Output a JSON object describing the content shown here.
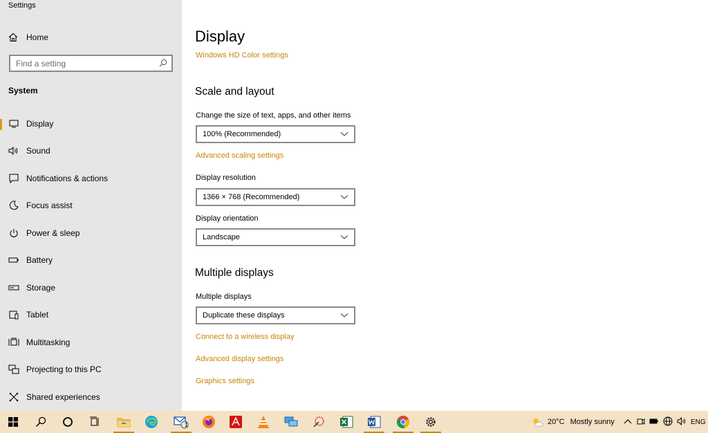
{
  "window": {
    "title": "Settings"
  },
  "sidebar": {
    "home_label": "Home",
    "search_placeholder": "Find a setting",
    "group_label": "System",
    "items": [
      {
        "label": "Display",
        "icon": "monitor-icon",
        "active": true
      },
      {
        "label": "Sound",
        "icon": "speaker-icon"
      },
      {
        "label": "Notifications & actions",
        "icon": "notification-icon"
      },
      {
        "label": "Focus assist",
        "icon": "moon-icon"
      },
      {
        "label": "Power & sleep",
        "icon": "power-icon"
      },
      {
        "label": "Battery",
        "icon": "battery-icon"
      },
      {
        "label": "Storage",
        "icon": "storage-icon"
      },
      {
        "label": "Tablet",
        "icon": "tablet-icon"
      },
      {
        "label": "Multitasking",
        "icon": "multitasking-icon"
      },
      {
        "label": "Projecting to this PC",
        "icon": "projecting-icon"
      },
      {
        "label": "Shared experiences",
        "icon": "shared-experiences-icon"
      }
    ]
  },
  "main": {
    "title": "Display",
    "hd_color_link": "Windows HD Color settings",
    "scale_section": {
      "heading": "Scale and layout",
      "scale_label": "Change the size of text, apps, and other items",
      "scale_value": "100% (Recommended)",
      "advanced_scaling_link": "Advanced scaling settings",
      "resolution_label": "Display resolution",
      "resolution_value": "1366 × 768 (Recommended)",
      "orientation_label": "Display orientation",
      "orientation_value": "Landscape"
    },
    "multi_section": {
      "heading": "Multiple displays",
      "label": "Multiple displays",
      "value": "Duplicate these displays",
      "wireless_link": "Connect to a wireless display",
      "advanced_display_link": "Advanced display settings",
      "graphics_link": "Graphics settings"
    }
  },
  "taskbar": {
    "mail_badge": "1",
    "weather": {
      "temp": "20°C",
      "condition": "Mostly sunny"
    },
    "language": "ENG"
  },
  "colors": {
    "accent": "#c8850a",
    "sidebar_bg": "#e6e6e6",
    "taskbar_bg": "#f3e2c6"
  }
}
